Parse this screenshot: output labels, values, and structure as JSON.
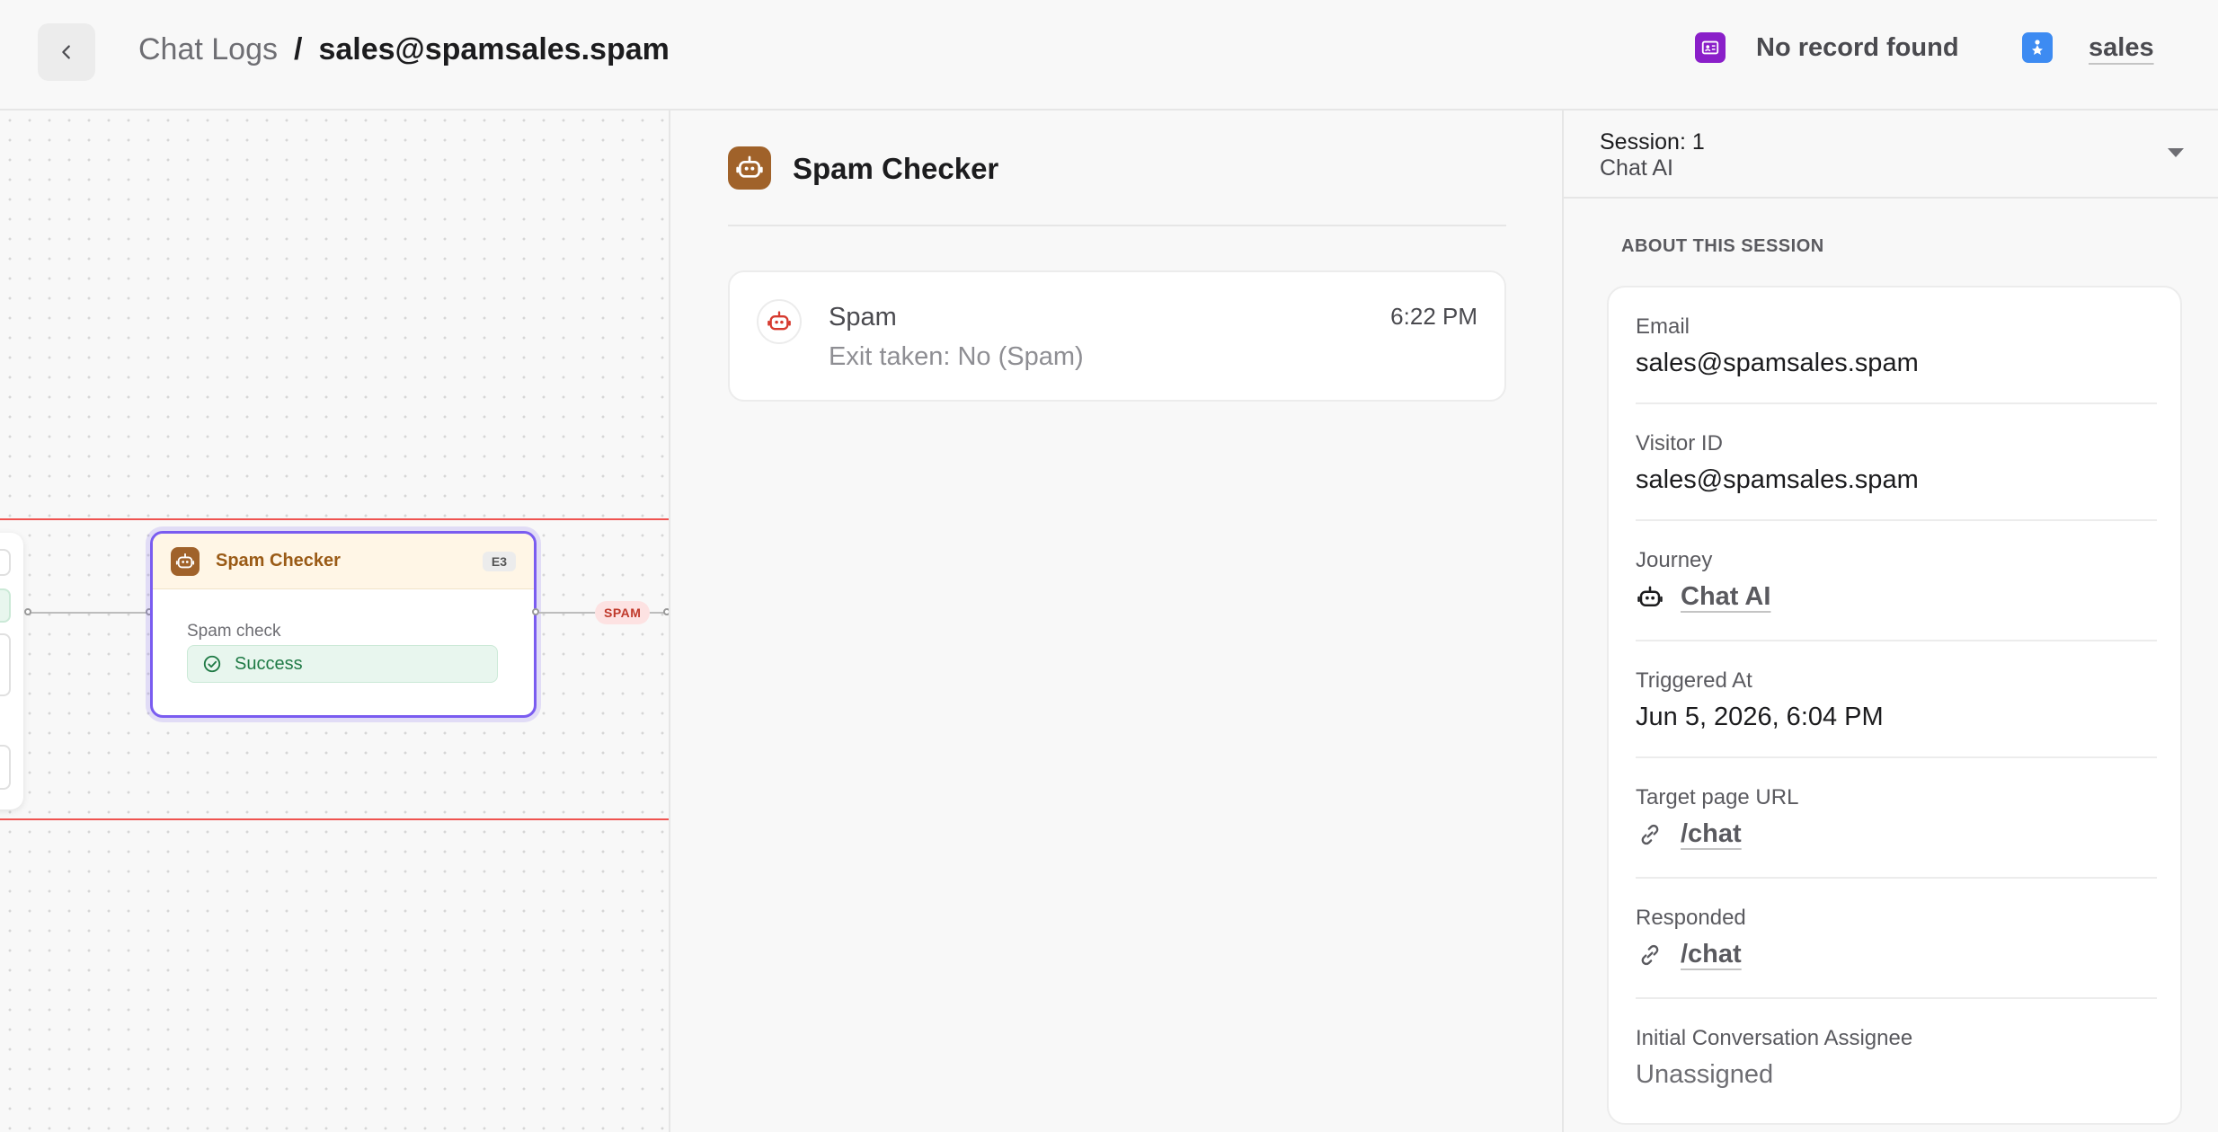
{
  "header": {
    "breadcrumb_parent": "Chat Logs",
    "breadcrumb_separator": "/",
    "breadcrumb_current": "sales@spamsales.spam",
    "record_status": "No record found",
    "user_name": "sales"
  },
  "canvas": {
    "node": {
      "title": "Spam Checker",
      "badge": "E3",
      "label": "Spam check",
      "status": "Success"
    },
    "edge_tag": "SPAM"
  },
  "middle": {
    "title": "Spam Checker",
    "log": {
      "title": "Spam",
      "time": "6:22 PM",
      "subtitle": "Exit taken: No (Spam)"
    }
  },
  "session": {
    "number": "Session: 1",
    "name": "Chat AI",
    "section_heading": "ABOUT THIS SESSION",
    "fields": {
      "email": {
        "label": "Email",
        "value": "sales@spamsales.spam"
      },
      "visitor_id": {
        "label": "Visitor ID",
        "value": "sales@spamsales.spam"
      },
      "journey": {
        "label": "Journey",
        "value": "Chat AI"
      },
      "triggered_at": {
        "label": "Triggered At",
        "value": "Jun 5, 2026, 6:04 PM"
      },
      "target_url": {
        "label": "Target page URL",
        "value": "/chat"
      },
      "responded": {
        "label": "Responded",
        "value": "/chat"
      },
      "assignee": {
        "label": "Initial Conversation Assignee",
        "value": "Unassigned"
      }
    }
  },
  "colors": {
    "accent_purple": "#7a5cf0",
    "node_brown": "#a0622a",
    "success_green": "#1f7a45",
    "spam_red": "#c0392b",
    "record_icon": "#8a1fc9",
    "user_icon": "#3d8bf2"
  }
}
